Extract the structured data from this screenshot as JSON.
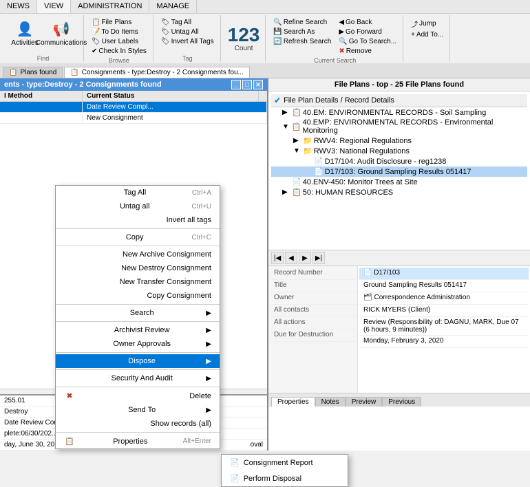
{
  "ribbon": {
    "tabs": [
      "NEWS",
      "VIEW",
      "ADMINISTRATION",
      "MANAGE"
    ],
    "active_tab": "VIEW",
    "groups": {
      "left": {
        "label": "Find",
        "btns": [
          {
            "label": "Activities",
            "icon": "👤"
          },
          {
            "label": "Communications",
            "icon": "📢"
          }
        ]
      },
      "browse": {
        "label": "Browse",
        "items": [
          {
            "label": "File Plans",
            "icon": "📋"
          },
          {
            "label": "To Do Items",
            "icon": "📝"
          },
          {
            "label": "User Labels",
            "icon": "🏷"
          },
          {
            "label": "Check In Styles",
            "icon": "✔"
          },
          {
            "label": " ",
            "icon": ""
          }
        ]
      },
      "tag": {
        "label": "Tag",
        "items": [
          {
            "label": "Tag All",
            "icon": "🏷"
          },
          {
            "label": "Untag All",
            "icon": "🏷"
          },
          {
            "label": "Invert All Tags",
            "icon": "🏷"
          }
        ]
      },
      "count": {
        "number": "123",
        "label": "Count"
      },
      "search": {
        "label": "Current Search",
        "items": [
          {
            "label": "Refine Search",
            "icon": "🔍"
          },
          {
            "label": "Search As",
            "icon": "💾"
          },
          {
            "label": "Refresh Search",
            "icon": "🔄"
          },
          {
            "label": "Go Back",
            "icon": "◀"
          },
          {
            "label": "Go Forward",
            "icon": "▶"
          },
          {
            "label": "Go To Search...",
            "icon": "🔍"
          },
          {
            "label": "Remove",
            "icon": "✖"
          }
        ]
      },
      "jump": {
        "label": "",
        "items": [
          {
            "label": "Jump",
            "icon": "⤴"
          },
          {
            "label": "Add To...",
            "icon": "+"
          }
        ]
      }
    }
  },
  "tabs_bar": [
    {
      "label": "Plans found",
      "icon": "📋",
      "active": false
    },
    {
      "label": "Consignments - type:Destroy - 2 Consignments fou...",
      "icon": "📋",
      "active": true
    }
  ],
  "left_panel": {
    "title": "ents - type:Destroy - 2 Consignments found",
    "columns": [
      {
        "label": "I Method",
        "width": 120
      },
      {
        "label": "Current Status",
        "width": 130
      }
    ],
    "rows": [
      {
        "method": "",
        "status": "Date Review Compl...",
        "selected": true
      },
      {
        "method": "",
        "status": "New Consignment",
        "selected": false
      }
    ],
    "bottom_rows": [
      {
        "col1": "255.01",
        "col2": ""
      },
      {
        "col1": "Destroy",
        "col2": ""
      },
      {
        "col1": "Date Review Comp...",
        "col2": ""
      },
      {
        "col1": "plete:06/30/202...",
        "col2": ""
      },
      {
        "col1": "day, June 30, 20...",
        "col2": "oval"
      }
    ]
  },
  "context_menu": {
    "items": [
      {
        "label": "Tag All",
        "shortcut": "Ctrl+A",
        "type": "item"
      },
      {
        "label": "Untag all",
        "shortcut": "Ctrl+U",
        "type": "item"
      },
      {
        "label": "Invert all tags",
        "shortcut": "",
        "type": "item"
      },
      {
        "type": "separator"
      },
      {
        "label": "Copy",
        "shortcut": "Ctrl+C",
        "type": "item"
      },
      {
        "type": "separator"
      },
      {
        "label": "New Archive Consignment",
        "type": "item"
      },
      {
        "label": "New Destroy Consignment",
        "type": "item"
      },
      {
        "label": "New Transfer Consignment",
        "type": "item"
      },
      {
        "label": "Copy Consignment",
        "type": "item"
      },
      {
        "type": "separator"
      },
      {
        "label": "Search",
        "type": "item",
        "has_arrow": true
      },
      {
        "type": "separator"
      },
      {
        "label": "Archivist Review",
        "type": "item",
        "has_arrow": true
      },
      {
        "label": "Owner Approvals",
        "type": "item",
        "has_arrow": true
      },
      {
        "type": "separator"
      },
      {
        "label": "Dispose",
        "type": "item",
        "has_arrow": true,
        "highlighted": true
      },
      {
        "type": "separator"
      },
      {
        "label": "Security And Audit",
        "type": "item",
        "has_arrow": true
      },
      {
        "type": "separator"
      },
      {
        "label": "Delete",
        "type": "item",
        "icon": "✖",
        "icon_color": "red"
      },
      {
        "label": "Send To",
        "type": "item",
        "has_arrow": true
      },
      {
        "label": "Show records (all)",
        "type": "item"
      },
      {
        "type": "separator"
      },
      {
        "label": "Properties",
        "shortcut": "Alt+Enter",
        "type": "item",
        "icon": "📋"
      }
    ]
  },
  "submenu": {
    "items": [
      {
        "label": "Consignment Report",
        "icon": "📄"
      },
      {
        "label": "Perform Disposal",
        "icon": "📄"
      }
    ]
  },
  "right_panel": {
    "title": "File Plans - top - 25 File Plans found",
    "tree": [
      {
        "label": "File Plan Details / Record Details",
        "depth": 0,
        "icon": "📋",
        "expand": ""
      },
      {
        "label": "40.EM: ENVIRONMENTAL RECORDS - Soil Sampling",
        "depth": 1,
        "icon": "📋",
        "expand": "▶"
      },
      {
        "label": "40.EMP: ENVIRONMENTAL RECORDS - Environmental Monitoring",
        "depth": 1,
        "icon": "📋",
        "expand": "▼",
        "selected": false
      },
      {
        "label": "RWV4: Regional Regulations",
        "depth": 2,
        "icon": "📁",
        "expand": "▶"
      },
      {
        "label": "RWV3: National Regulations",
        "depth": 2,
        "icon": "📁",
        "expand": "▼"
      },
      {
        "label": "D17/104: Audit Disclosure - reg1238",
        "depth": 3,
        "icon": "📄",
        "expand": ""
      },
      {
        "label": "D17/103: Ground Sampling Results 051417",
        "depth": 3,
        "icon": "📄",
        "expand": "",
        "selected": true
      },
      {
        "label": "40.ENV-450: Monitor Trees at Site",
        "depth": 1,
        "icon": "📄",
        "expand": ""
      },
      {
        "label": "50: HUMAN RESOURCES",
        "depth": 1,
        "icon": "📋",
        "expand": "▶"
      }
    ],
    "properties": {
      "fields": [
        {
          "label": "Record Number",
          "value": "D17/103"
        },
        {
          "label": "Title",
          "value": "Ground Sampling Results 051417"
        },
        {
          "label": "Owner",
          "value": "Correspondence Administration"
        },
        {
          "label": "All contacts",
          "value": "RICK MYERS (Client)"
        },
        {
          "label": "All actions",
          "value": "Review (Responsibility of: DAGNU, MARK, Due 07 (6 hours, 9 minutes))"
        },
        {
          "label": "Due for Destruction",
          "value": "Monday, February 3, 2020"
        }
      ]
    },
    "bottom_tabs": [
      "Properties",
      "Notes",
      "Preview",
      "Previous"
    ],
    "active_tab": "Properties"
  }
}
